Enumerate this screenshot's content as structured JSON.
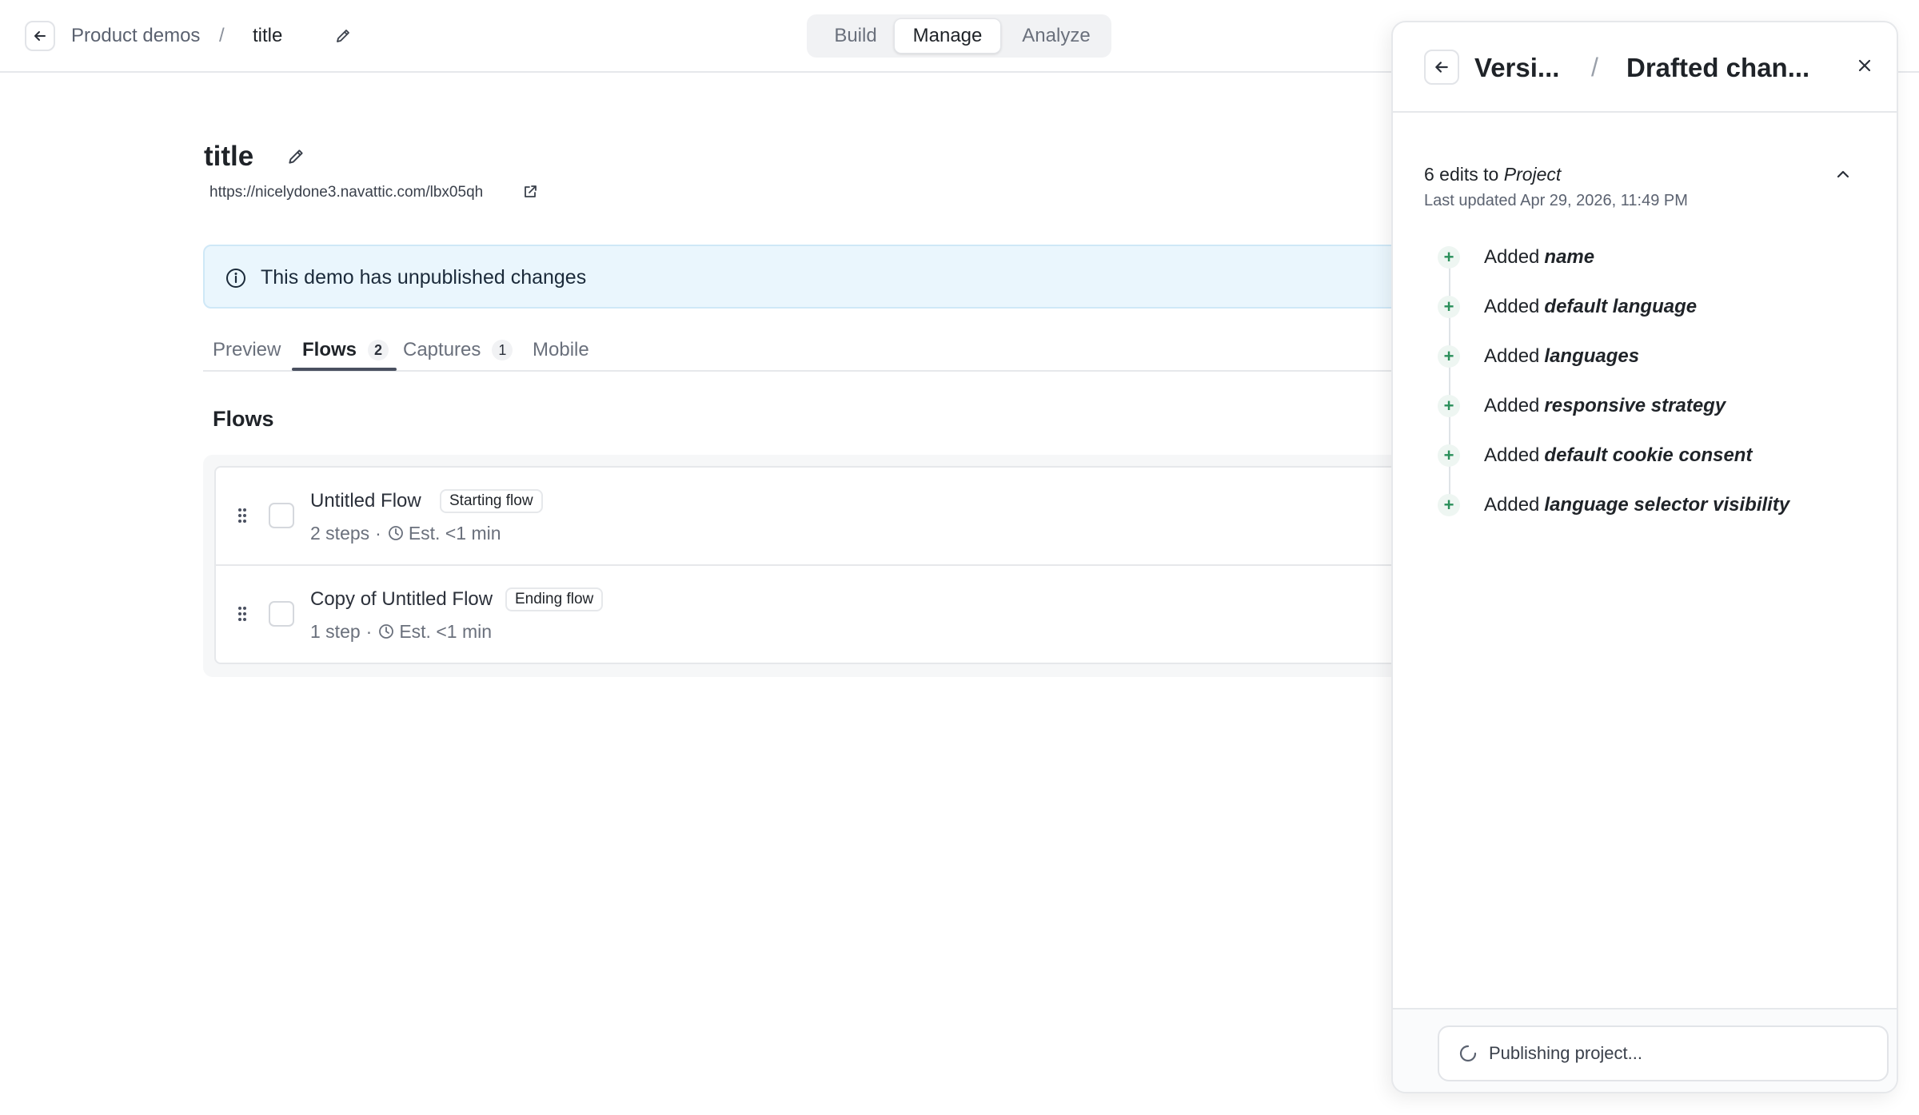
{
  "header": {
    "breadcrumb_parent": "Product demos",
    "breadcrumb_separator": "/",
    "breadcrumb_current": "title",
    "modes": [
      {
        "label": "Build",
        "active": false
      },
      {
        "label": "Manage",
        "active": true
      },
      {
        "label": "Analyze",
        "active": false
      }
    ]
  },
  "main": {
    "title": "title",
    "url": "https://nicelydone3.navattic.com/lbx05qh",
    "banner_text": "This demo has unpublished changes",
    "tabs": [
      {
        "label": "Preview",
        "count": ""
      },
      {
        "label": "Flows",
        "count": "2"
      },
      {
        "label": "Captures",
        "count": "1"
      },
      {
        "label": "Mobile",
        "count": ""
      }
    ],
    "active_tab": "Flows",
    "flows_heading": "Flows",
    "flows": [
      {
        "name": "Untitled Flow",
        "badge": "Starting flow",
        "steps": "2 steps",
        "sep": "·",
        "estimate": "Est. <1 min"
      },
      {
        "name": "Copy of Untitled Flow",
        "badge": "Ending flow",
        "steps": "1 step",
        "sep": "·",
        "estimate": "Est. <1 min"
      }
    ]
  },
  "panel": {
    "crumb_1": "Versi...",
    "crumb_separator": "/",
    "crumb_2": "Drafted chan...",
    "edits_count_text": "6 edits to",
    "edits_target": "Project",
    "last_updated": "Last updated Apr 29, 2026, 11:49 PM",
    "changes": [
      {
        "action": "Added",
        "field": "name"
      },
      {
        "action": "Added",
        "field": "default language"
      },
      {
        "action": "Added",
        "field": "languages"
      },
      {
        "action": "Added",
        "field": "responsive strategy"
      },
      {
        "action": "Added",
        "field": "default cookie consent"
      },
      {
        "action": "Added",
        "field": "language selector visibility"
      }
    ],
    "publish_status": "Publishing project..."
  },
  "icons": [
    "arrow-left-icon",
    "pencil-icon",
    "external-link-icon",
    "info-icon",
    "drag-handle-icon",
    "clock-icon",
    "close-icon",
    "chevron-up-icon",
    "plus-icon",
    "spinner-icon"
  ],
  "colors": {
    "banner_bg": "#eaf6fd",
    "added_accent": "#2a8f5a",
    "active_tab_underline": "#4a5060"
  }
}
